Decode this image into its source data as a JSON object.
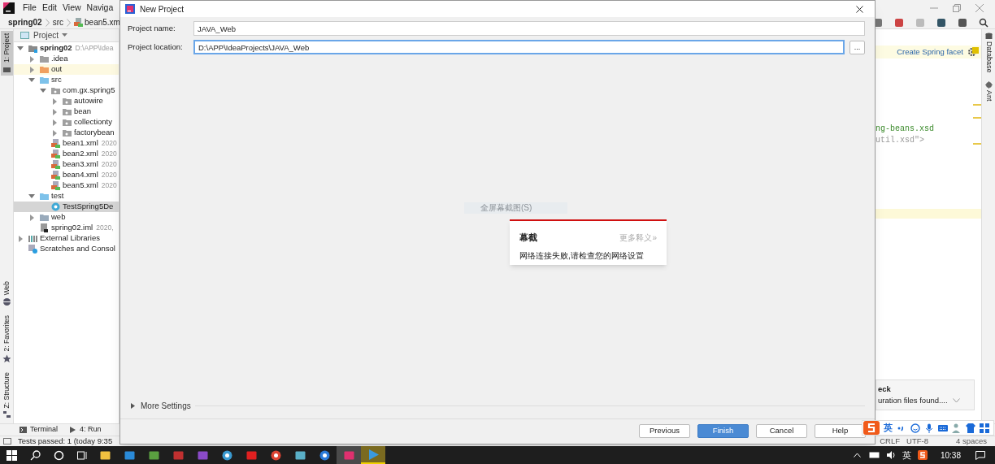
{
  "ide": {
    "menu": [
      "File",
      "Edit",
      "View",
      "Naviga"
    ],
    "breadcrumb": [
      "spring02",
      "src",
      "bean5.xm"
    ],
    "left_strip": [
      {
        "label": "1: Project",
        "selected": true
      },
      {
        "label": "Web",
        "selected": false
      },
      {
        "label": "2: Favorites",
        "selected": false
      },
      {
        "label": "Z: Structure",
        "selected": false
      }
    ],
    "project_panel": {
      "title": "Project",
      "tree": [
        {
          "kind": "module",
          "label": "spring02",
          "detail": "D:\\APP\\Idea",
          "expanded": true,
          "selected": false,
          "children": [
            {
              "kind": "folder",
              "label": ".idea",
              "expanded": false,
              "selected": false
            },
            {
              "kind": "excluded-folder",
              "label": "out",
              "expanded": false,
              "selected": false
            },
            {
              "kind": "source-folder",
              "label": "src",
              "expanded": true,
              "selected": false,
              "children": [
                {
                  "kind": "package",
                  "label": "com.gx.spring5",
                  "expanded": true,
                  "selected": false,
                  "children": [
                    {
                      "kind": "package",
                      "label": "autowire",
                      "expanded": false,
                      "selected": false
                    },
                    {
                      "kind": "package",
                      "label": "bean",
                      "expanded": false,
                      "selected": false
                    },
                    {
                      "kind": "package",
                      "label": "collectionty",
                      "expanded": false,
                      "selected": false
                    },
                    {
                      "kind": "package",
                      "label": "factorybean",
                      "expanded": false,
                      "selected": false
                    }
                  ]
                },
                {
                  "kind": "xml",
                  "label": "bean1.xml",
                  "detail": "2020",
                  "selected": false
                },
                {
                  "kind": "xml",
                  "label": "bean2.xml",
                  "detail": "2020",
                  "selected": false
                },
                {
                  "kind": "xml",
                  "label": "bean3.xml",
                  "detail": "2020",
                  "selected": false
                },
                {
                  "kind": "xml",
                  "label": "bean4.xml",
                  "detail": "2020",
                  "selected": false
                },
                {
                  "kind": "xml",
                  "label": "bean5.xml",
                  "detail": "2020",
                  "selected": false
                }
              ]
            },
            {
              "kind": "test-folder",
              "label": "test",
              "expanded": true,
              "selected": false,
              "children": [
                {
                  "kind": "class",
                  "label": "TestSpring5De",
                  "selected": true
                }
              ]
            },
            {
              "kind": "web-folder",
              "label": "web",
              "expanded": false,
              "selected": false
            },
            {
              "kind": "iml",
              "label": "spring02.iml",
              "detail": "2020,",
              "selected": false
            }
          ]
        },
        {
          "kind": "libraries",
          "label": "External Libraries",
          "expanded": false,
          "selected": false
        },
        {
          "kind": "scratches",
          "label": "Scratches and Consol",
          "selected": false
        }
      ]
    },
    "facet_banner": "Create Spring facet",
    "code_lines": [
      {
        "text": "ng-beans.xsd",
        "kind": "string"
      },
      {
        "text": "util.xsd\">",
        "kind": "tag"
      }
    ],
    "right_strip": [
      "Database",
      "Ant"
    ],
    "notification": {
      "title": "eck",
      "text": "uration files found...."
    },
    "bottom_tabs": [
      "Terminal",
      "4: Run"
    ],
    "status_left": "Tests passed: 1 (today 9:35",
    "status_right": [
      "CRLF",
      "UTF-8",
      "4 spaces"
    ]
  },
  "dialog": {
    "title": "New Project",
    "fields": [
      {
        "label": "Project name:",
        "value": "JAVA_Web",
        "focused": false
      },
      {
        "label": "Project location:",
        "value": "D:\\APP\\IdeaProjects\\JAVA_Web",
        "focused": true,
        "browse": "..."
      }
    ],
    "more_settings": {
      "label": "More Settings",
      "expanded": false
    },
    "buttons": [
      {
        "label": "Previous",
        "primary": false
      },
      {
        "label": "Finish",
        "primary": true
      },
      {
        "label": "Cancel",
        "primary": false
      },
      {
        "label": "Help",
        "primary": false
      }
    ]
  },
  "screenshot_hint": "全屏幕截图(S)",
  "popup": {
    "title": "幕截",
    "link": "更多释义»",
    "message": "网络连接失败,请检查您的网络设置"
  },
  "ime_bar": {
    "mode": "英"
  },
  "taskbar": {
    "apps": [
      {
        "kind": "explorer",
        "selected": false,
        "flashing": false
      },
      {
        "kind": "mail",
        "selected": false,
        "flashing": false
      },
      {
        "kind": "notes",
        "selected": false,
        "flashing": false
      },
      {
        "kind": "cloud",
        "selected": false,
        "flashing": false
      },
      {
        "kind": "vs",
        "selected": false,
        "flashing": false
      },
      {
        "kind": "photos",
        "selected": false,
        "flashing": false
      },
      {
        "kind": "red-app",
        "selected": false,
        "flashing": false
      },
      {
        "kind": "chrome",
        "selected": false,
        "flashing": false
      },
      {
        "kind": "book",
        "selected": false,
        "flashing": false
      },
      {
        "kind": "edge",
        "selected": false,
        "flashing": false
      },
      {
        "kind": "idea",
        "selected": true,
        "flashing": false
      },
      {
        "kind": "player",
        "selected": false,
        "flashing": true
      }
    ],
    "tray": {
      "language": "英",
      "time": "10:38"
    }
  }
}
